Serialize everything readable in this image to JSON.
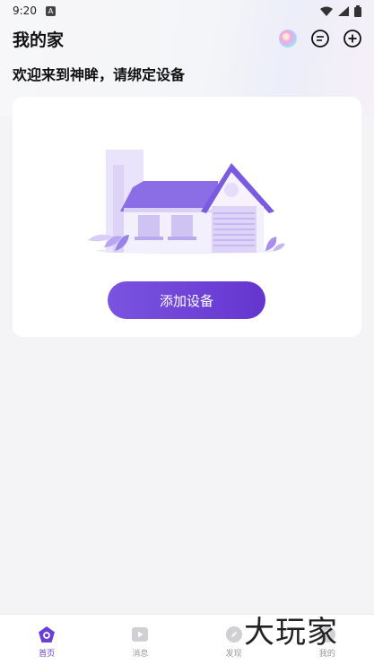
{
  "status_bar": {
    "time": "9:20",
    "notification_icon": "A"
  },
  "header": {
    "title": "我的家"
  },
  "welcome_text": "欢迎来到神眸，请绑定设备",
  "card": {
    "add_device_label": "添加设备"
  },
  "bottom_nav": [
    {
      "label": "首页",
      "icon": "home-icon",
      "active": true
    },
    {
      "label": "消息",
      "icon": "play-icon",
      "active": false
    },
    {
      "label": "发现",
      "icon": "compass-icon",
      "active": false
    },
    {
      "label": "我的",
      "icon": "profile-icon",
      "active": false
    }
  ],
  "watermark": "大玩家",
  "colors": {
    "accent": "#6a3fd6",
    "background": "#f4f4f6",
    "card": "#ffffff"
  }
}
